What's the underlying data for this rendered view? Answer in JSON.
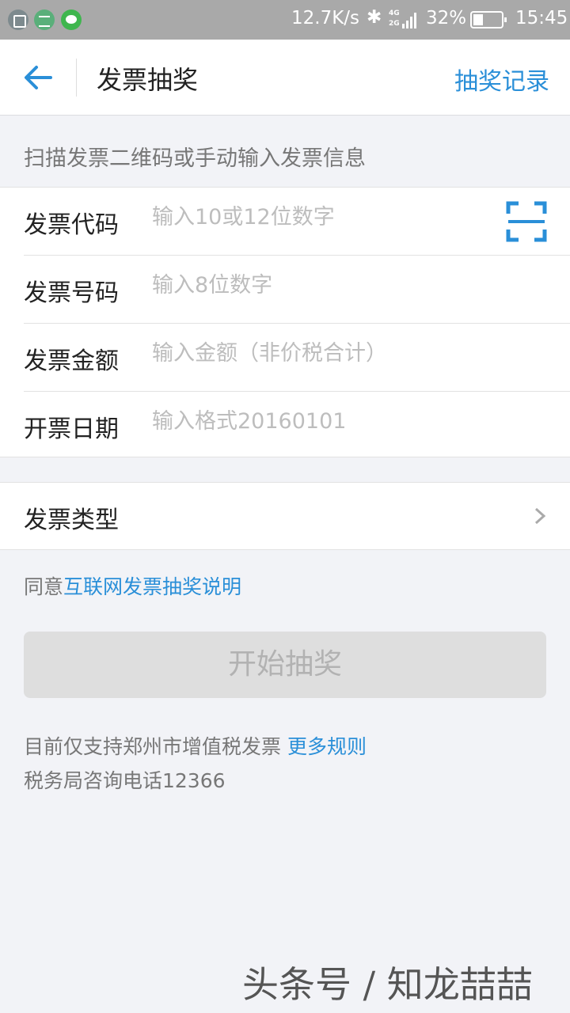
{
  "status_bar": {
    "speed": "12.7K/s",
    "bluetooth_icon": "bluetooth-icon",
    "network": "4G\n2G",
    "battery_percent": "32%",
    "time": "15:45"
  },
  "header": {
    "title": "发票抽奖",
    "record_link": "抽奖记录"
  },
  "hint": "扫描发票二维码或手动输入发票信息",
  "form": {
    "code_label": "发票代码",
    "code_placeholder": "输入10或12位数字",
    "number_label": "发票号码",
    "number_placeholder": "输入8位数字",
    "amount_label": "发票金额",
    "amount_placeholder": "输入金额（非价税合计）",
    "date_label": "开票日期",
    "date_placeholder": "输入格式20160101"
  },
  "type_row": {
    "label": "发票类型"
  },
  "agreement": {
    "prefix": "同意",
    "link": "互联网发票抽奖说明"
  },
  "start_button": "开始抽奖",
  "notes": {
    "support": "目前仅支持郑州市增值税发票",
    "more_rules": "更多规则",
    "phone": "税务局咨询电话12366"
  },
  "watermark": "头条号 / 知龙喆喆",
  "colors": {
    "accent": "#2a8fd8",
    "background": "#f2f3f7",
    "disabled_button": "#dedede"
  }
}
